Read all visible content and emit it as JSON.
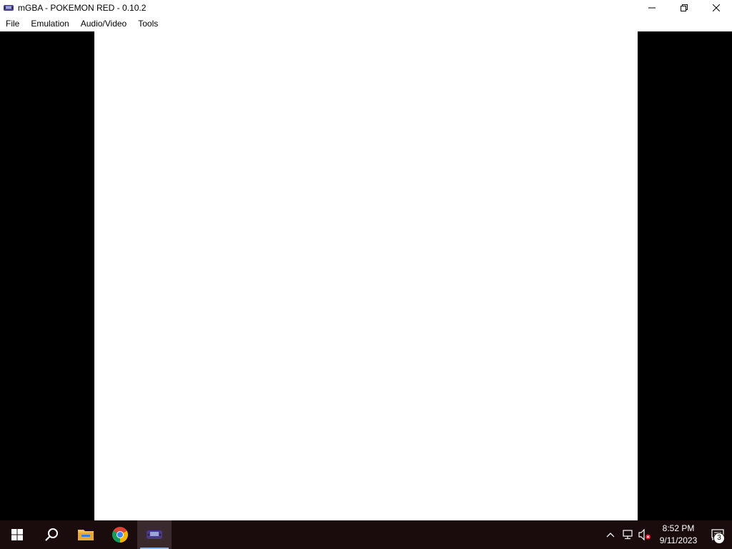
{
  "window": {
    "title": "mGBA - POKEMON RED - 0.10.2",
    "app_icon": "mgba-gameboy-icon",
    "controls": [
      "minimize-icon",
      "restore-icon",
      "close-icon"
    ]
  },
  "menubar": {
    "items": [
      "File",
      "Emulation",
      "Audio/Video",
      "Tools"
    ]
  },
  "game_screen": {
    "state": "blank white"
  },
  "taskbar": {
    "apps": [
      {
        "name": "start-icon",
        "active": false
      },
      {
        "name": "search-icon",
        "active": false
      },
      {
        "name": "file-explorer-icon",
        "active": false
      },
      {
        "name": "chrome-icon",
        "active": false
      },
      {
        "name": "mgba-taskbar-icon",
        "active": true
      }
    ],
    "tray": {
      "clock_time": "8:52 PM",
      "clock_date": "9/11/2023",
      "notification_count": "3"
    }
  },
  "colors": {
    "taskbar_bg": "#1a0b0d",
    "active_underline": "#8fb7e6"
  }
}
